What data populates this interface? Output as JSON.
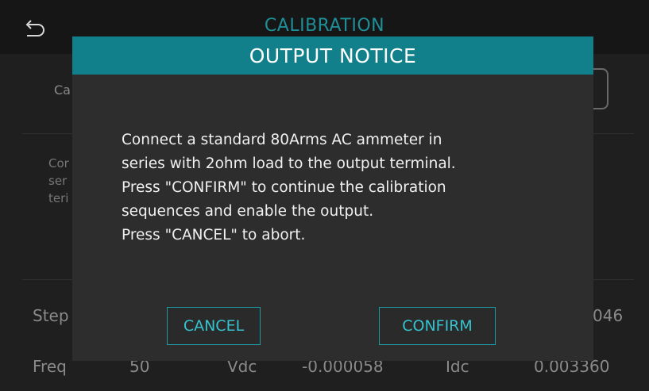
{
  "background": {
    "page_title": "CALIBRATION",
    "field_label": "Ca",
    "note_lines": [
      "Cor",
      "ser",
      "teri"
    ],
    "step_label": "Step",
    "step_value": "046",
    "freq_label": "Freq",
    "freq_value": "50",
    "vdc_label": "Vdc",
    "vdc_value": "-0.000058",
    "idc_label": "Idc",
    "idc_value": "0.003360"
  },
  "modal": {
    "title": "OUTPUT NOTICE",
    "message_lines": [
      "Connect a standard 80Arms AC ammeter in",
      "series with 2ohm load to the output terminal.",
      "Press \"CONFIRM\" to continue the calibration",
      "sequences and enable the output.",
      "Press \"CANCEL\" to abort."
    ],
    "cancel_label": "CANCEL",
    "confirm_label": "CONFIRM"
  },
  "colors": {
    "accent": "#12808a",
    "button_text": "#35c3cf",
    "modal_bg": "#2d2d2d"
  },
  "icons": {
    "back": "back-arrow-icon"
  }
}
